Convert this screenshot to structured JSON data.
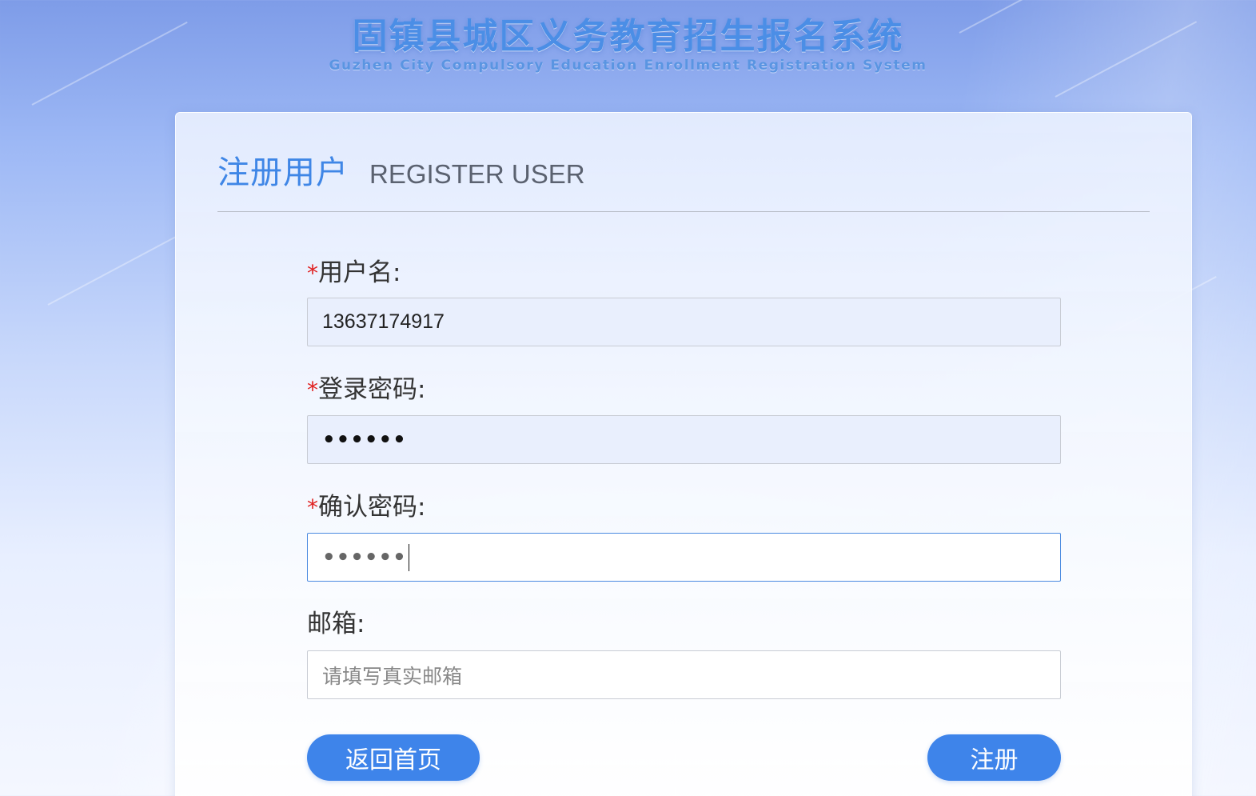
{
  "header": {
    "title_cn": "固镇县城区义务教育招生报名系统",
    "title_en": "Guzhen City Compulsory Education Enrollment Registration System"
  },
  "card": {
    "title_cn": "注册用户",
    "title_en": "REGISTER USER"
  },
  "form": {
    "required_mark": "*",
    "username": {
      "label": "用户名:",
      "value": "13637174917"
    },
    "password": {
      "label": "登录密码:",
      "masked_value": "••••••"
    },
    "confirm_password": {
      "label": "确认密码:",
      "masked_value": "••••••"
    },
    "email": {
      "label": "邮箱:",
      "placeholder": "请填写真实邮箱",
      "value": ""
    }
  },
  "buttons": {
    "back_home": "返回首页",
    "register": "注册"
  },
  "colors": {
    "accent": "#3e84ea",
    "required": "#e02020",
    "title": "#4b8ee6"
  }
}
